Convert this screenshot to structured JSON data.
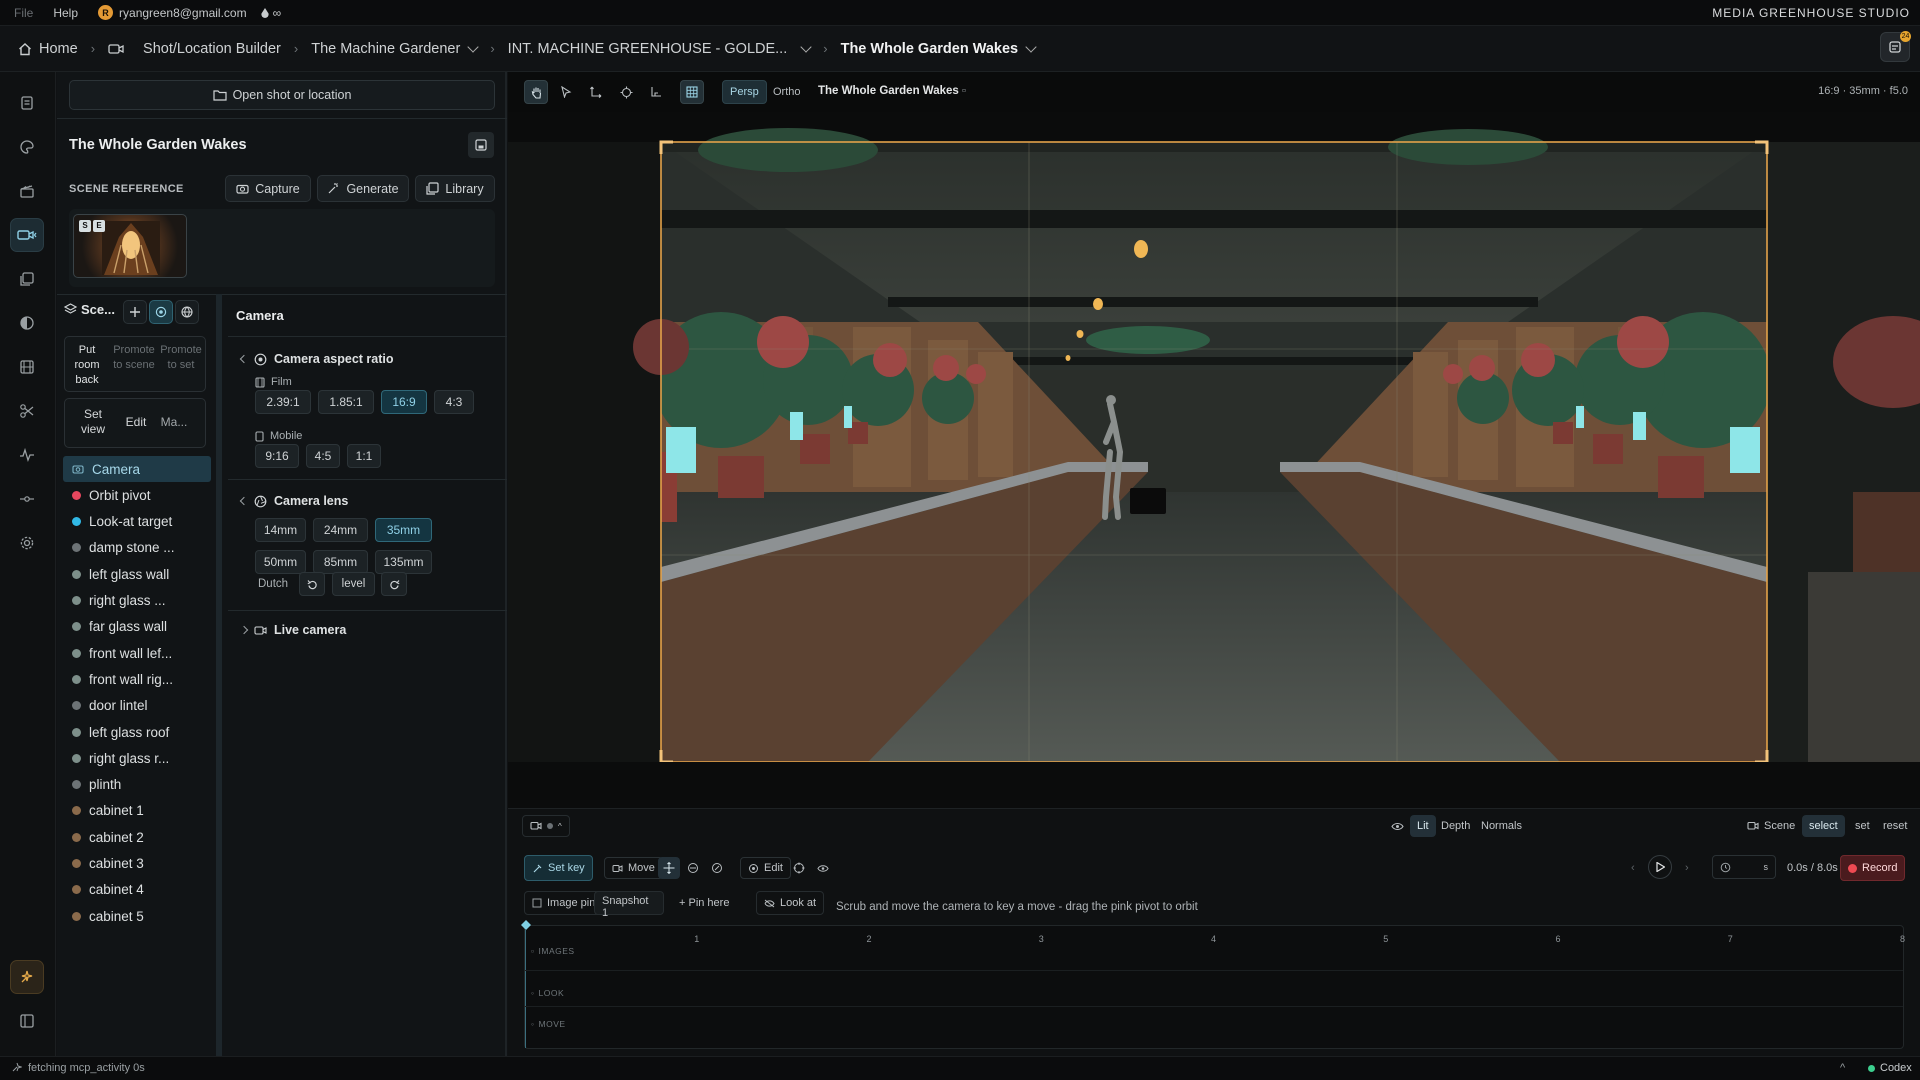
{
  "menubar": {
    "items": [
      "File",
      "Help"
    ],
    "account_initial": "R",
    "account_email": "ryangreen8@gmail.com",
    "extra": "∞",
    "studio": "MEDIA GREENHOUSE STUDIO"
  },
  "breadcrumb": {
    "home": "Home",
    "builder": "Shot/Location Builder",
    "project": "The Machine Gardener",
    "location": "INT. MACHINE GREENHOUSE - GOLDE...",
    "shot": "The Whole Garden Wakes"
  },
  "notifications": {
    "count": "24"
  },
  "left": {
    "open_shot": "Open shot or location",
    "scene_title": "The Whole Garden Wakes",
    "scene_reference_label": "SCENE REFERENCE",
    "ref_buttons": {
      "capture": "Capture",
      "generate": "Generate",
      "library": "Library"
    },
    "thumb_tags": [
      "S",
      "E"
    ]
  },
  "outliner": {
    "title": "Sce...",
    "put_actions": {
      "put": "Put room back",
      "promote_scene": "Promote to scene",
      "promote_set": "Promote to set"
    },
    "set_actions": {
      "set_view": "Set view",
      "edit": "Edit",
      "more": "Ma..."
    },
    "rows": [
      {
        "label": "Camera",
        "dot": "#5b6a70",
        "active": true
      },
      {
        "label": "Orbit pivot",
        "dot": "#e6475e"
      },
      {
        "label": "Look-at target",
        "dot": "#31b9e6"
      },
      {
        "label": "damp stone ...",
        "dot": "#6d7376"
      },
      {
        "label": "left glass wall",
        "dot": "#7d8f8a"
      },
      {
        "label": "right glass ...",
        "dot": "#7d8f8a"
      },
      {
        "label": "far glass wall",
        "dot": "#7d8f8a"
      },
      {
        "label": "front wall lef...",
        "dot": "#7d8f8a"
      },
      {
        "label": "front wall rig...",
        "dot": "#7d8f8a"
      },
      {
        "label": "door lintel",
        "dot": "#6d7376"
      },
      {
        "label": "left glass roof",
        "dot": "#7d8f8a"
      },
      {
        "label": "right glass r...",
        "dot": "#7d8f8a"
      },
      {
        "label": "plinth",
        "dot": "#6d7376"
      },
      {
        "label": "cabinet 1",
        "dot": "#8a6a4b"
      },
      {
        "label": "cabinet 2",
        "dot": "#8a6a4b"
      },
      {
        "label": "cabinet 3",
        "dot": "#8a6a4b"
      },
      {
        "label": "cabinet 4",
        "dot": "#8a6a4b"
      },
      {
        "label": "cabinet 5",
        "dot": "#8a6a4b"
      }
    ]
  },
  "camera": {
    "title": "Camera",
    "aspect_header": "Camera aspect ratio",
    "film_label": "Film",
    "film_ratios": [
      "2.39:1",
      "1.85:1",
      "16:9",
      "4:3"
    ],
    "film_selected": "16:9",
    "mobile_label": "Mobile",
    "mobile_ratios": [
      "9:16",
      "4:5",
      "1:1"
    ],
    "lens_header": "Camera lens",
    "lenses": [
      "14mm",
      "24mm",
      "35mm",
      "50mm",
      "85mm",
      "135mm"
    ],
    "lens_selected": "35mm",
    "dutch_label": "Dutch",
    "dutch_level": "level",
    "live_camera": "Live camera"
  },
  "viewport": {
    "persp": "Persp",
    "ortho": "Ortho",
    "title": "The Whole Garden Wakes",
    "stats": "16:9 · 35mm · f5.0",
    "accent": "#e3a24a"
  },
  "bottom": {
    "render_modes": [
      "Lit",
      "Depth",
      "Normals"
    ],
    "render_selected": "Lit",
    "scene_label": "Scene",
    "scene_actions": [
      "select",
      "set",
      "reset"
    ],
    "set_key": "Set key",
    "move": "Move",
    "edit": "Edit",
    "time": "0.0s / 8.0s",
    "duration_unit": "s",
    "record": "Record",
    "image_pin": "Image pin",
    "snapshot": "Snapshot 1",
    "pin_here": "+ Pin here",
    "look_at": "Look at",
    "hint": "Scrub and move the camera to key a move - drag the pink pivot to orbit",
    "ticks": [
      "1",
      "2",
      "3",
      "4",
      "5",
      "6",
      "7",
      "8"
    ],
    "tracks": [
      "IMAGES",
      "LOOK",
      "MOVE"
    ]
  },
  "status": {
    "left": "fetching mcp_activity 0s",
    "right": "Codex"
  }
}
